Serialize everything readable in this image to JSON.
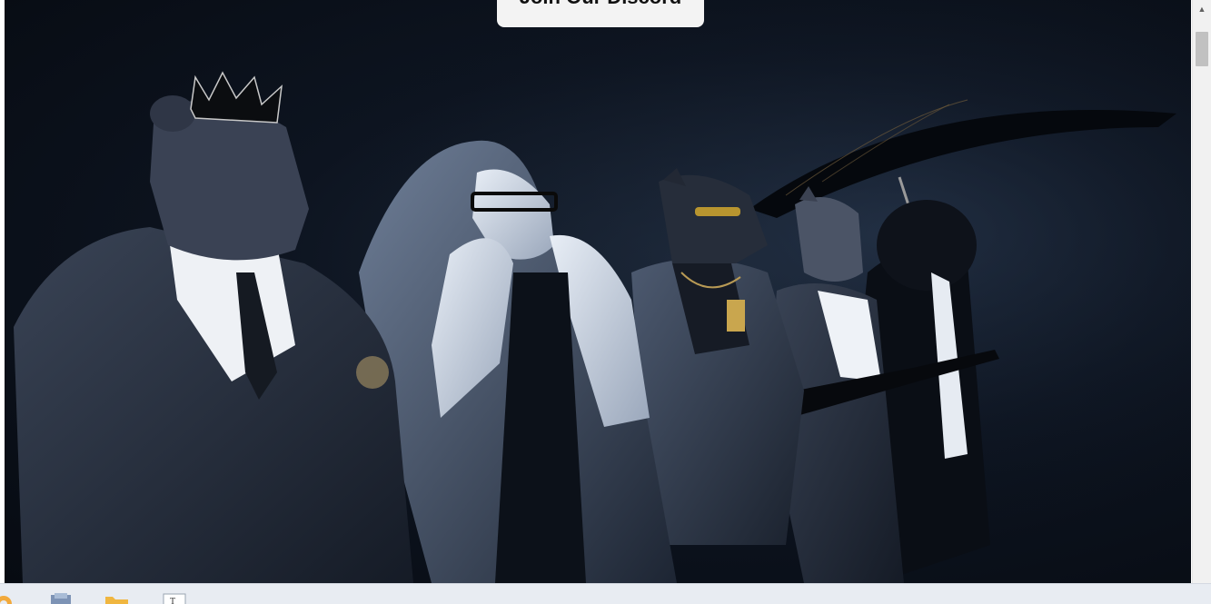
{
  "hero": {
    "cta_label": "Join Our Discord",
    "image_description_icon": "character-lineup-illustration"
  },
  "taskbar": {
    "items": [
      {
        "icon": "browser-icon"
      },
      {
        "icon": "file-explorer-icon"
      },
      {
        "icon": "folder-icon"
      },
      {
        "icon": "text-editor-icon"
      }
    ]
  },
  "colors": {
    "hero_bg": "#0d1420",
    "button_bg": "#f3f3f3",
    "taskbar_bg": "#e8ecf2"
  }
}
